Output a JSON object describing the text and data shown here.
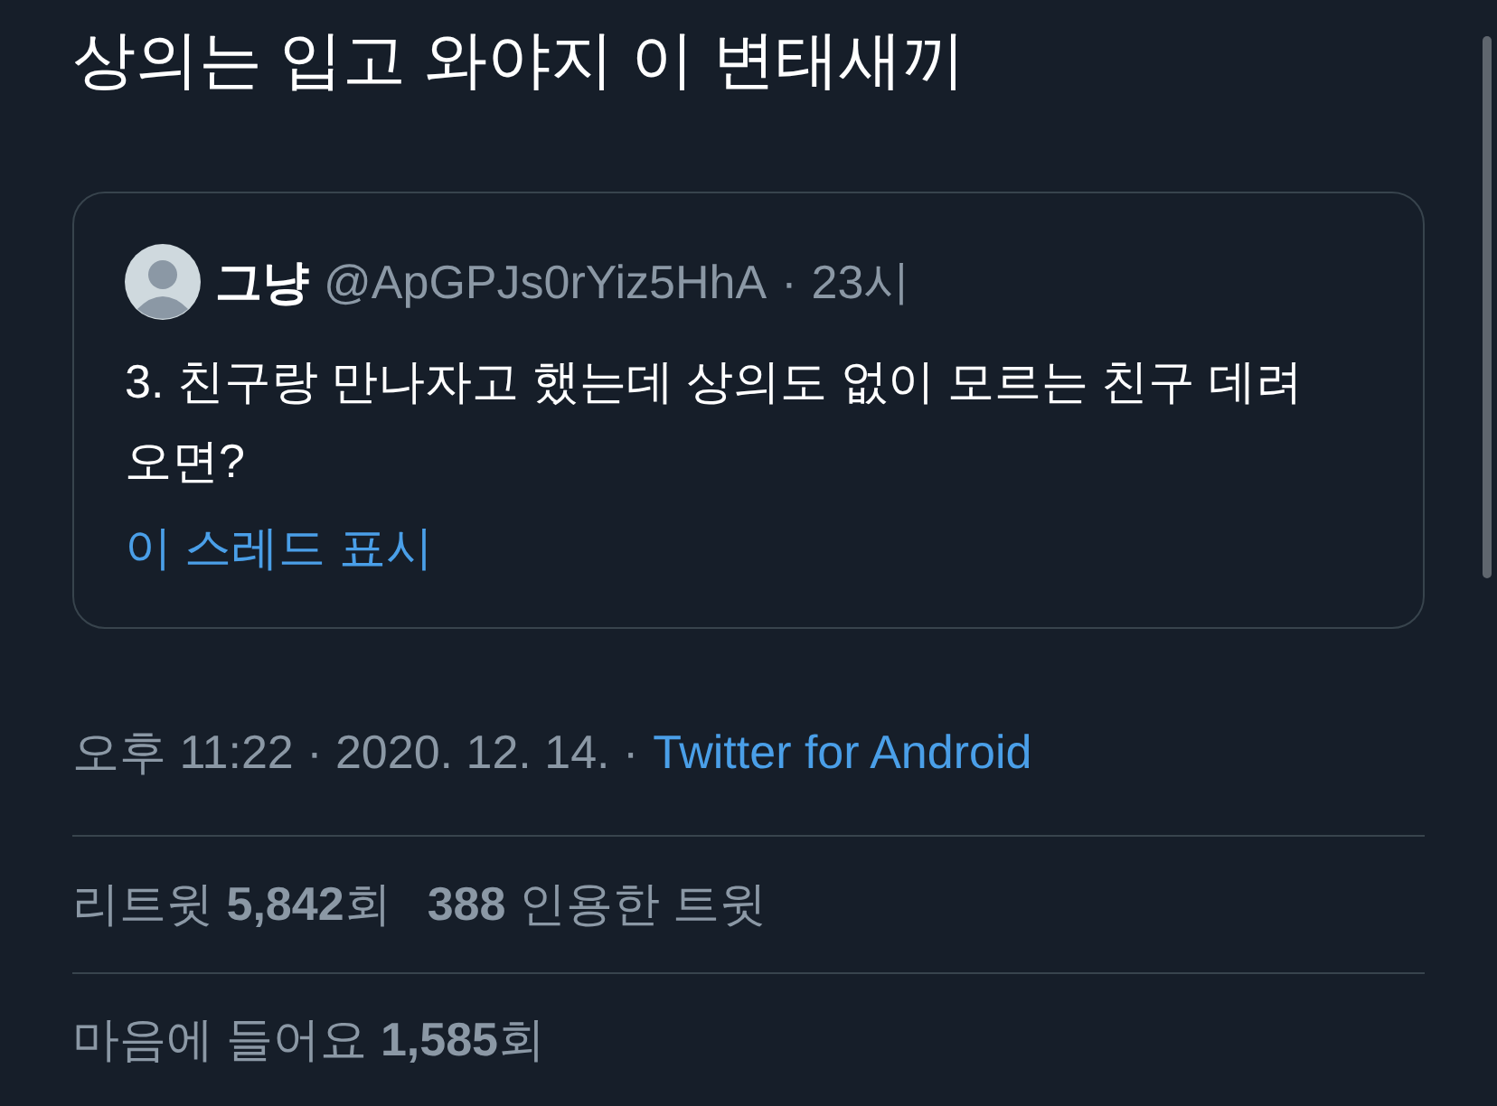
{
  "tweet_text": "상의는 입고 와야지 이 변태새끼",
  "quoted_tweet": {
    "author_name": "그냥",
    "handle": "@ApGPJs0rYiz5HhA",
    "separator": "·",
    "time": "23시",
    "text": "3. 친구랑 만나자고 했는데 상의도 없이 모르는 친구 데려오면?",
    "thread_link": "이 스레드 표시"
  },
  "timestamp": "오후 11:22 · 2020. 12. 14. ·",
  "source": "Twitter for Android",
  "stats": [
    "리트윗 **5,842**회",
    "**388** 인용한 트윗"
  ],
  "likes": "마음에 들어요 **1,585**회"
}
